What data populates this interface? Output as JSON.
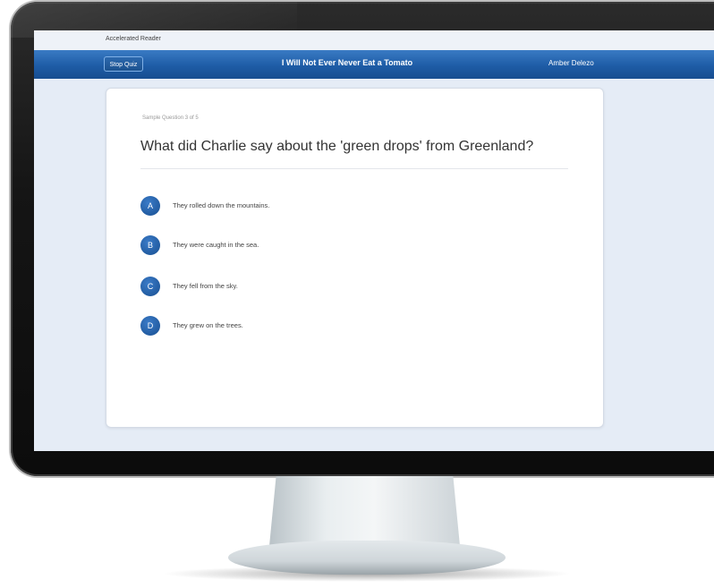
{
  "app": {
    "title": "Accelerated Reader"
  },
  "header": {
    "stop_quiz_label": "Stop Quiz",
    "book_title": "I Will Not Ever Never Eat a Tomato",
    "user_name": "Amber Delezo"
  },
  "quiz": {
    "progress": "Sample Question 3 of 5",
    "question": "What did Charlie say about the 'green drops' from Greenland?",
    "answers": [
      {
        "letter": "A",
        "text": "They rolled down the mountains."
      },
      {
        "letter": "B",
        "text": "They were caught in the sea."
      },
      {
        "letter": "C",
        "text": "They fell from the sky."
      },
      {
        "letter": "D",
        "text": "They grew on the trees."
      }
    ]
  },
  "colors": {
    "header_blue": "#1e5ca6",
    "answer_circle": "#1e5ca6",
    "screen_bg": "#e5ecf6"
  }
}
